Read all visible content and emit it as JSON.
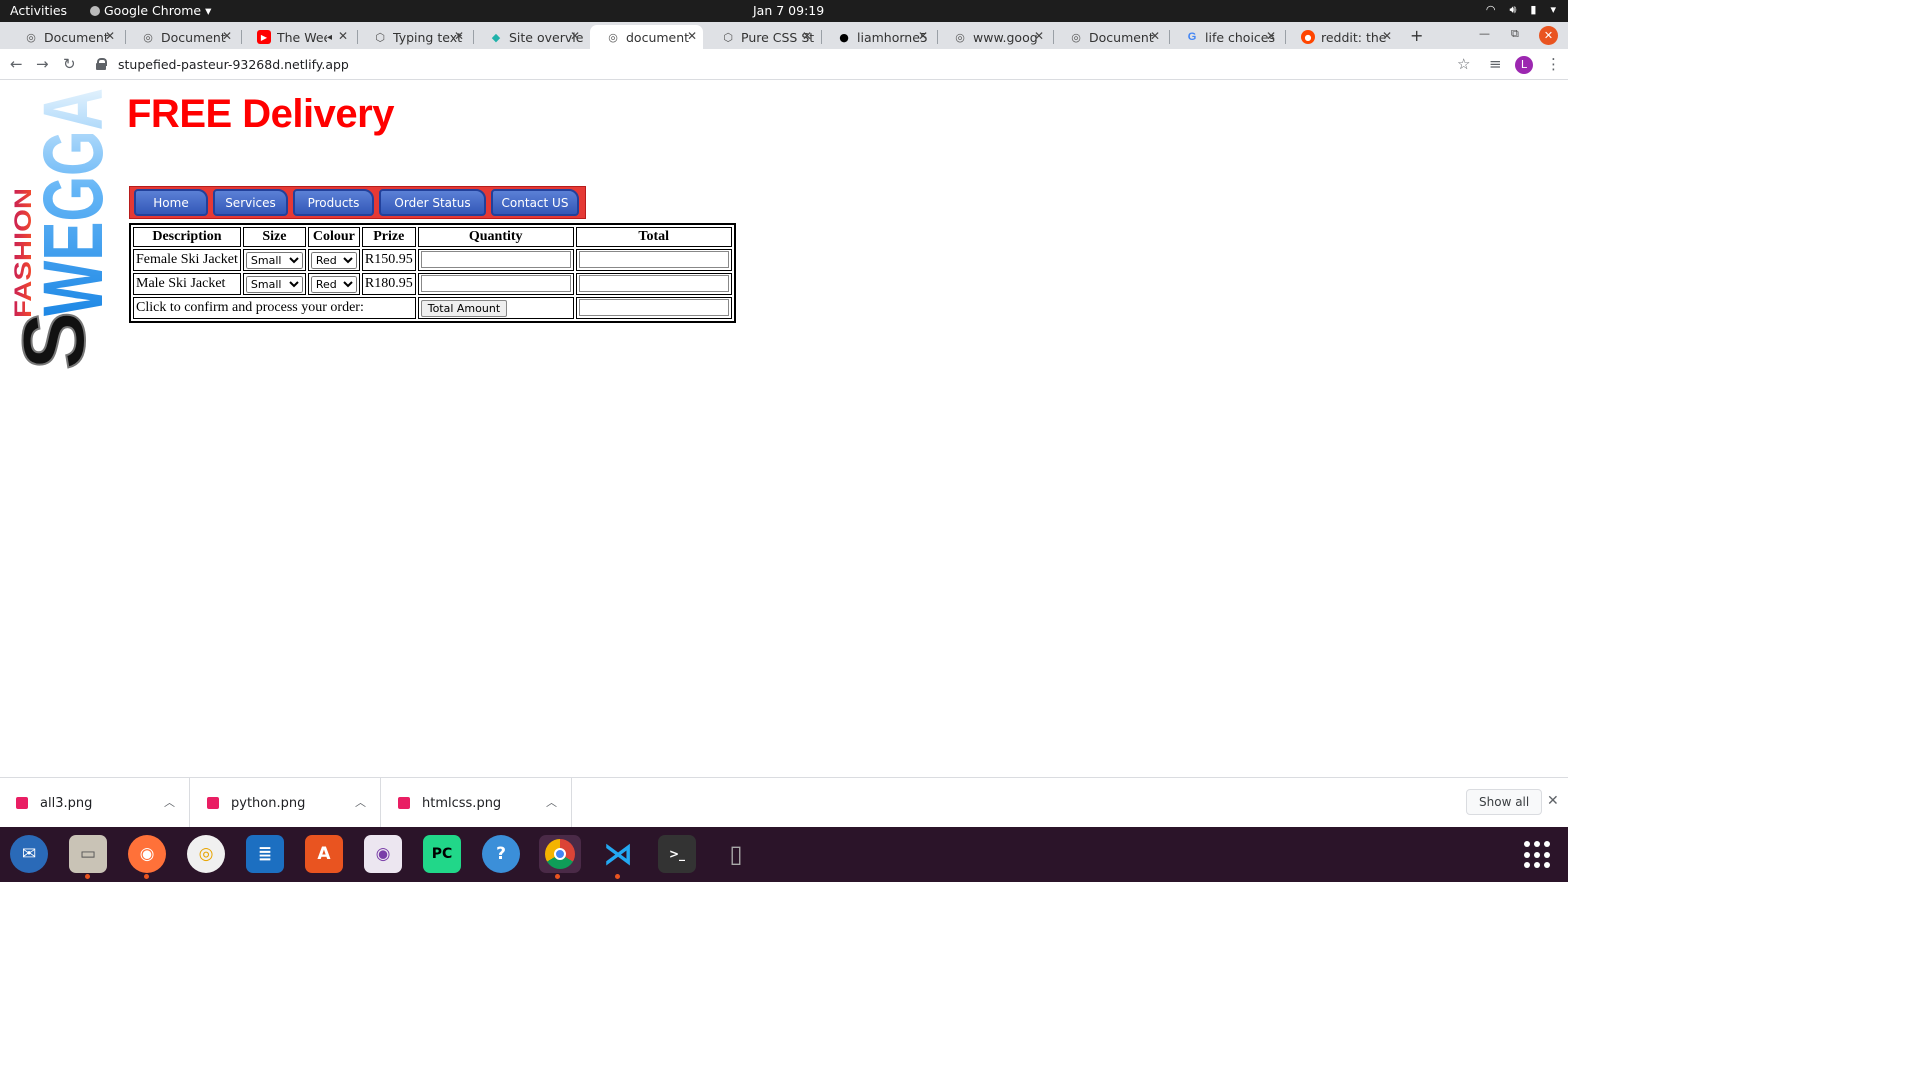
{
  "topbar": {
    "activities": "Activities",
    "app_name": "Google Chrome",
    "clock": "Jan 7  09:19"
  },
  "tabs": [
    {
      "label": "Document",
      "icon": "globe-icon"
    },
    {
      "label": "Document",
      "icon": "globe-icon"
    },
    {
      "label": "The Wee",
      "icon": "youtube-icon"
    },
    {
      "label": "Typing text",
      "icon": "codepen-icon"
    },
    {
      "label": "Site overvie",
      "icon": "netlify-icon"
    },
    {
      "label": "document",
      "icon": "globe-icon",
      "active": true
    },
    {
      "label": "Pure CSS St",
      "icon": "codepen-icon"
    },
    {
      "label": "liamhorne5",
      "icon": "github-icon"
    },
    {
      "label": "www.goog",
      "icon": "globe-icon"
    },
    {
      "label": "Document",
      "icon": "globe-icon"
    },
    {
      "label": "life choices",
      "icon": "google-icon"
    },
    {
      "label": "reddit: the",
      "icon": "reddit-icon"
    }
  ],
  "url": "stupefied-pasteur-93268d.netlify.app",
  "avatar_letter": "L",
  "page": {
    "headline": "FREE Delivery",
    "logo": {
      "top_word": "FASHION",
      "brand": "SWEGGA"
    },
    "nav": [
      "Home",
      "Services",
      "Products",
      "Order Status",
      "Contact US"
    ],
    "table": {
      "headers": [
        "Description",
        "Size",
        "Colour",
        "Prize",
        "Quantity",
        "Total"
      ],
      "rows": [
        {
          "description": "Female Ski Jacket",
          "size": "Small",
          "colour": "Red",
          "prize": "R150.95",
          "quantity": "",
          "total": ""
        },
        {
          "description": "Male Ski Jacket",
          "size": "Small",
          "colour": "Red",
          "prize": "R180.95",
          "quantity": "",
          "total": ""
        }
      ],
      "confirm_text": "Click to confirm and process your order:",
      "total_button": "Total Amount",
      "grand_total": ""
    }
  },
  "downloads": [
    {
      "name": "all3.png"
    },
    {
      "name": "python.png"
    },
    {
      "name": "htmlcss.png"
    }
  ],
  "downloads_show_all": "Show all",
  "colors": {
    "headline": "#ff0000",
    "nav_bg": "#e53935",
    "nav_button": "#3f66c6",
    "dock": "#2b1429"
  }
}
